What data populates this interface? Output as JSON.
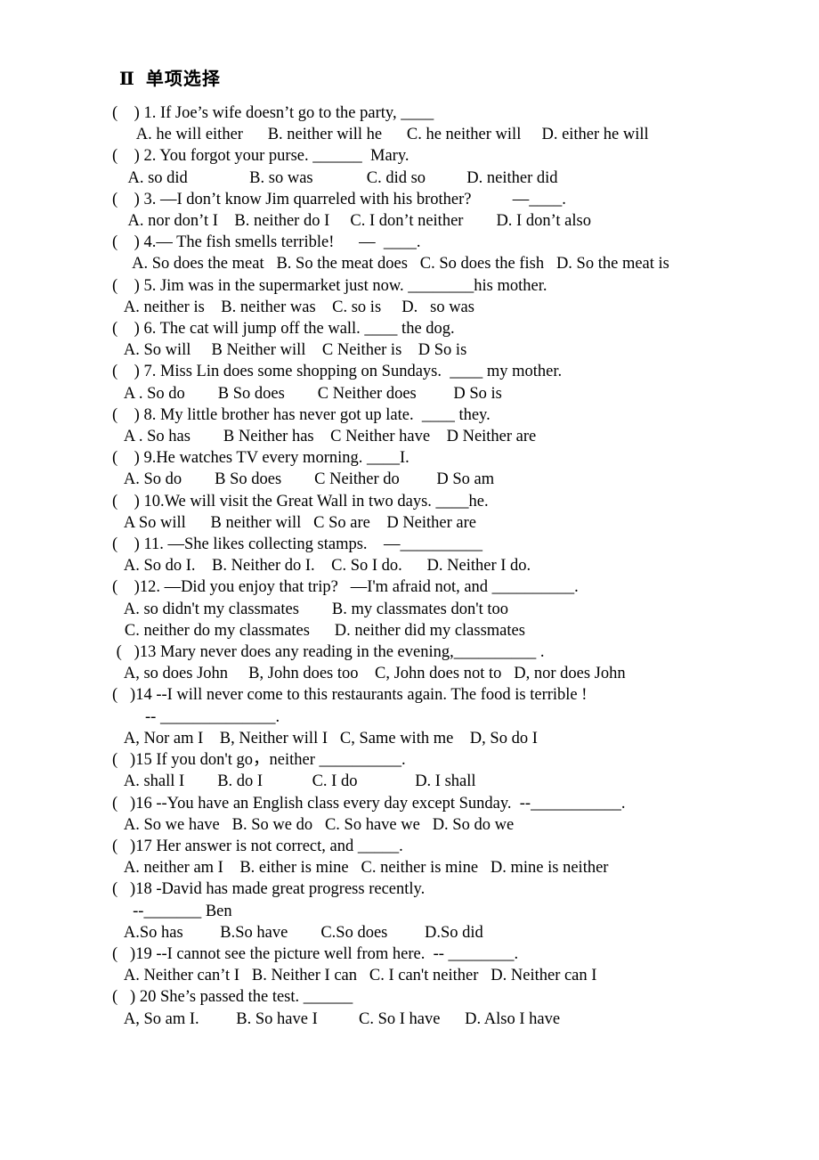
{
  "document": {
    "section_title": "Ⅱ  单项选择",
    "questions": [
      {
        "stem": "(    ) 1. If Joe’s wife doesn’t go to the party, ____",
        "options": "      A. he will either      B. neither will he      C. he neither will     D. either he will"
      },
      {
        "stem": "(    ) 2. You forgot your purse. ______  Mary.",
        "options": "    A. so did               B. so was             C. did so          D. neither did"
      },
      {
        "stem": "(    ) 3. —I don’t know Jim quarreled with his brother?          —____.",
        "options": "    A. nor don’t I    B. neither do I     C. I don’t neither        D. I don’t also"
      },
      {
        "stem": "(    ) 4.— The fish smells terrible!      —  ____.",
        "options": "     A. So does the meat   B. So the meat does   C. So does the fish   D. So the meat is"
      },
      {
        "stem": "(    ) 5. Jim was in the supermarket just now. ________his mother.",
        "options": "   A. neither is    B. neither was    C. so is     D.   so was"
      },
      {
        "stem": "(    ) 6. The cat will jump off the wall. ____ the dog.",
        "options": "   A. So will     B Neither will    C Neither is    D So is"
      },
      {
        "stem": "(    ) 7. Miss Lin does some shopping on Sundays.  ____ my mother.",
        "options": "   A . So do        B So does        C Neither does         D So is"
      },
      {
        "stem": "(    ) 8. My little brother has never got up late.  ____ they.",
        "options": "   A . So has        B Neither has    C Neither have    D Neither are"
      },
      {
        "stem": "(    ) 9.He watches TV every morning. ____I.",
        "options": "   A. So do        B So does        C Neither do         D So am"
      },
      {
        "stem": "(    ) 10.We will visit the Great Wall in two days. ____he.",
        "options": "   A So will      B neither will   C So are    D Neither are"
      },
      {
        "stem": "(    ) 11. —She likes collecting stamps.    —__________",
        "options": "   A. So do I.    B. Neither do I.    C. So I do.      D. Neither I do."
      },
      {
        "stem": "(    )12. —Did you enjoy that trip?   —I'm afraid not, and __________.",
        "options": "   A. so didn't my classmates        B. my classmates don't too",
        "options2": "   C. neither do my classmates      D. neither did my classmates"
      },
      {
        "stem": " (   )13 Mary never does any reading in the evening,__________ .",
        "options": "   A, so does John     B, John does too    C, John does not to   D, nor does John"
      },
      {
        "stem": "(   )14 --I will never come to this restaurants again. The food is terrible !",
        "extra": "        -- ______________.",
        "options": "   A, Nor am I    B, Neither will I   C, Same with me    D, So do I"
      },
      {
        "stem": "(   )15 If you don't go，neither __________.",
        "options": "   A. shall I        B. do I            C. I do              D. I shall"
      },
      {
        "stem": "(   )16 --You have an English class every day except Sunday.  --___________.",
        "options": "   A. So we have   B. So we do   C. So have we   D. So do we"
      },
      {
        "stem": "(   )17 Her answer is not correct, and _____.",
        "options": "   A. neither am I    B. either is mine   C. neither is mine   D. mine is neither"
      },
      {
        "stem": "(   )18 -David has made great progress recently.",
        "extra": "     --_______ Ben",
        "options": "   A.So has         B.So have        C.So does         D.So did"
      },
      {
        "stem": "(   )19 --I cannot see the picture well from here.  -- ________.",
        "options": "   A. Neither can’t I   B. Neither I can   C. I can't neither   D. Neither can I"
      },
      {
        "stem": "(   ) 20 She’s passed the test. ______",
        "options": "   A, So am I.         B. So have I          C. So I have      D. Also I have"
      }
    ]
  }
}
